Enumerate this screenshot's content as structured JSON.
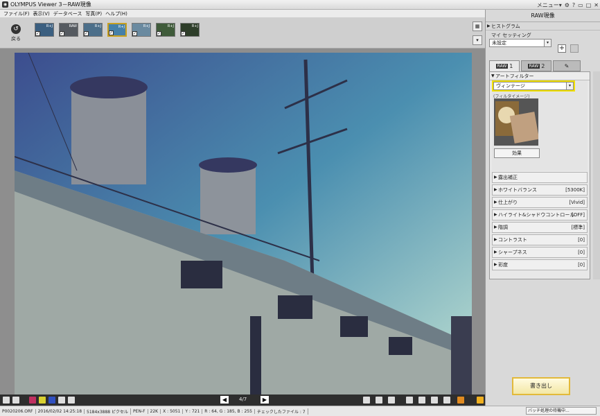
{
  "window": {
    "app_name": "OLYMPUS Viewer 3",
    "mode": "RAW現像",
    "title_separator": " － ",
    "menu_label": "メニュー▾"
  },
  "menu": [
    "ファイル(F)",
    "表示(V)",
    "データベース",
    "写真(P)",
    "ヘルプ(H)"
  ],
  "toolbar": {
    "back_label": "戻る",
    "thumbnails": [
      {
        "tag": "R+J",
        "color": "#3b5f80"
      },
      {
        "tag": "RAW",
        "color": "#555a60"
      },
      {
        "tag": "R+J",
        "color": "#4c6f8a"
      },
      {
        "tag": "R+J",
        "color": "#4580a8",
        "selected": true
      },
      {
        "tag": "R+J",
        "color": "#6a8aa0"
      },
      {
        "tag": "R+J",
        "color": "#3f5b3a"
      },
      {
        "tag": "R+J",
        "color": "#2e3e2a"
      }
    ]
  },
  "viewer": {
    "page": "4/7"
  },
  "status": {
    "filename": "P0020206.ORF",
    "datetime": "2016/02/02 14:25:18",
    "resolution": "5184x3888 ピクセル",
    "camera": "PEN-F",
    "lens": "22K",
    "coord_x": "X : 5051",
    "coord_y": "Y : 721",
    "rgb": "R : 64, G : 185, B : 255",
    "checked": "チェックしたファイル : 7",
    "batch": "バッチ処理の待機中..."
  },
  "panel": {
    "title": "RAW現像",
    "histogram": "ヒストグラム",
    "my_setting_label": "マイ セッティング",
    "my_setting_value": "未設定",
    "tabs": [
      {
        "badge": "RAW",
        "num": "1"
      },
      {
        "badge": "RAW",
        "num": "2"
      }
    ],
    "art_filter": {
      "label": "アートフィルター",
      "value": "ヴィンテージ",
      "preview_label": "(フィルタイメージ)",
      "effect_button": "効果"
    },
    "rows": [
      {
        "label": "露出補正",
        "value": ""
      },
      {
        "label": "ホワイトバランス",
        "value": "[5300K]"
      },
      {
        "label": "仕上がり",
        "value": "[Vivid]"
      },
      {
        "label": "ハイライト&シャドウコントロール",
        "value": "[OFF]"
      },
      {
        "label": "階調",
        "value": "[標準]"
      },
      {
        "label": "コントラスト",
        "value": "[0]"
      },
      {
        "label": "シャープネス",
        "value": "[0]"
      },
      {
        "label": "彩度",
        "value": "[0]"
      }
    ],
    "save_button": "書き出し"
  },
  "colors": {
    "highlight": "#f2e000",
    "save_border": "#e2b93a"
  }
}
